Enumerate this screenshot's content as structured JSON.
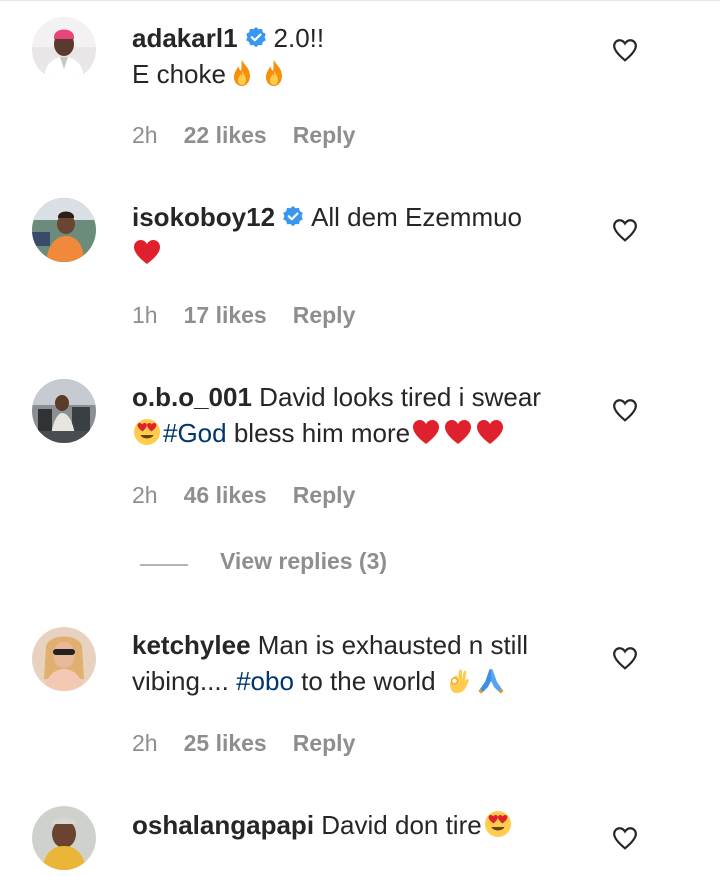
{
  "comments": [
    {
      "username": "adakarl1",
      "verified": true,
      "text_line1": "2.0!!",
      "text_line2": "E choke",
      "time": "2h",
      "likes": "22 likes",
      "reply": "Reply"
    },
    {
      "username": "isokoboy12",
      "verified": true,
      "text_line1": "All dem Ezemmuo",
      "time": "1h",
      "likes": "17 likes",
      "reply": "Reply"
    },
    {
      "username": "o.b.o_001",
      "verified": false,
      "text_line1": "David looks tired i swear",
      "hashtag": "#God",
      "text_after_tag": "bless him more",
      "time": "2h",
      "likes": "46 likes",
      "reply": "Reply"
    },
    {
      "username": "ketchylee",
      "verified": false,
      "text_line1": "Man is exhausted n still",
      "text_line2_start": "vibing....",
      "hashtag": "#obo",
      "text_after_tag": "to the world",
      "time": "2h",
      "likes": "25 likes",
      "reply": "Reply"
    },
    {
      "username": "oshalangapapi",
      "verified": false,
      "text_line1": "David don tire"
    }
  ],
  "view_replies": "View replies (3)",
  "icons": {
    "like": "heart-outline-icon",
    "verified": "verified-badge-icon",
    "fire": "fire-emoji",
    "red_heart": "red-heart-emoji",
    "heart_eyes": "heart-eyes-emoji",
    "ok_hand": "ok-hand-emoji",
    "folded_hands": "folded-hands-emoji"
  },
  "colors": {
    "text": "#262626",
    "meta": "#8e8e8e",
    "hashtag": "#00376b",
    "verified": "#3897f0"
  }
}
